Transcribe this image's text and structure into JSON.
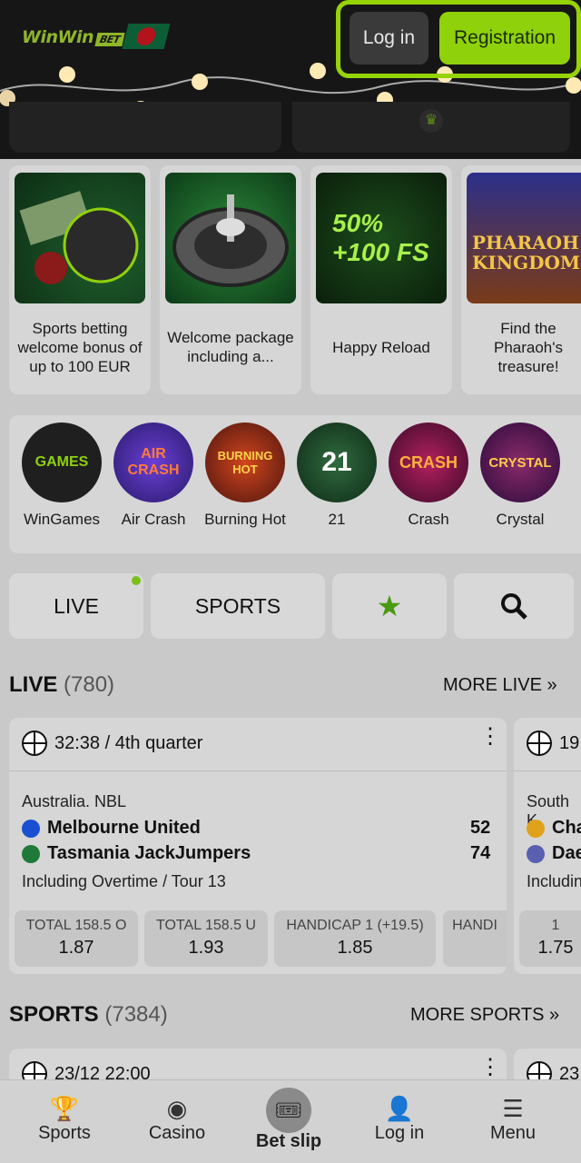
{
  "header": {
    "logo_text": "WinWin",
    "logo_badge": "BET",
    "login_label": "Log in",
    "register_label": "Registration",
    "accent_color": "#8fd10a"
  },
  "promos": [
    {
      "label": "Sports betting welcome bonus of up to 100 EUR"
    },
    {
      "label": "Welcome package including a..."
    },
    {
      "label": "Happy Reload",
      "image_text": "50% +100 FS"
    },
    {
      "label": "Find the Pharaoh's treasure!",
      "image_text": "PHARAOH KINGDOM"
    }
  ],
  "games": [
    {
      "label": "WinGames",
      "art_text": "GAMES"
    },
    {
      "label": "Air Crash",
      "art_text": "AIR CRASH"
    },
    {
      "label": "Burning Hot",
      "art_text": "BURNING HOT"
    },
    {
      "label": "21",
      "art_text": "21"
    },
    {
      "label": "Crash",
      "art_text": "CRASH"
    },
    {
      "label": "Crystal",
      "art_text": "CRYSTAL"
    }
  ],
  "tabs": {
    "live": "LIVE",
    "sports": "SPORTS",
    "favorites_icon": "star-icon",
    "search_icon": "search-icon"
  },
  "live_section": {
    "title": "LIVE",
    "count": "(780)",
    "more": "MORE LIVE »"
  },
  "live_card": {
    "time": "32:38 / 4th quarter",
    "league": "Australia. NBL",
    "team1": "Melbourne United",
    "score1": "52",
    "team2": "Tasmania JackJumpers",
    "score2": "74",
    "extra": "Including Overtime / Tour 13",
    "odds": [
      {
        "label": "TOTAL 158.5 O",
        "value": "1.87"
      },
      {
        "label": "TOTAL 158.5 U",
        "value": "1.93"
      },
      {
        "label": "HANDICAP 1 (+19.5)",
        "value": "1.85"
      },
      {
        "label": "HANDI",
        "value": ""
      }
    ]
  },
  "live_card2": {
    "time": "19",
    "league": "South K",
    "team1": "Cha",
    "team2": "Dae",
    "extra": "Includin",
    "odd_label": "1",
    "odd_value": "1.75"
  },
  "sports_section": {
    "title": "SPORTS",
    "count": "(7384)",
    "more": "MORE SPORTS »"
  },
  "sports_card": {
    "time": "23/12 22:00"
  },
  "sports_card2": {
    "time": "23"
  },
  "bottom_nav": [
    {
      "label": "Sports",
      "icon": "trophy-icon"
    },
    {
      "label": "Casino",
      "icon": "chip-icon"
    },
    {
      "label": "Bet slip",
      "icon": "ticket-icon"
    },
    {
      "label": "Log in",
      "icon": "user-icon"
    },
    {
      "label": "Menu",
      "icon": "menu-icon"
    }
  ]
}
